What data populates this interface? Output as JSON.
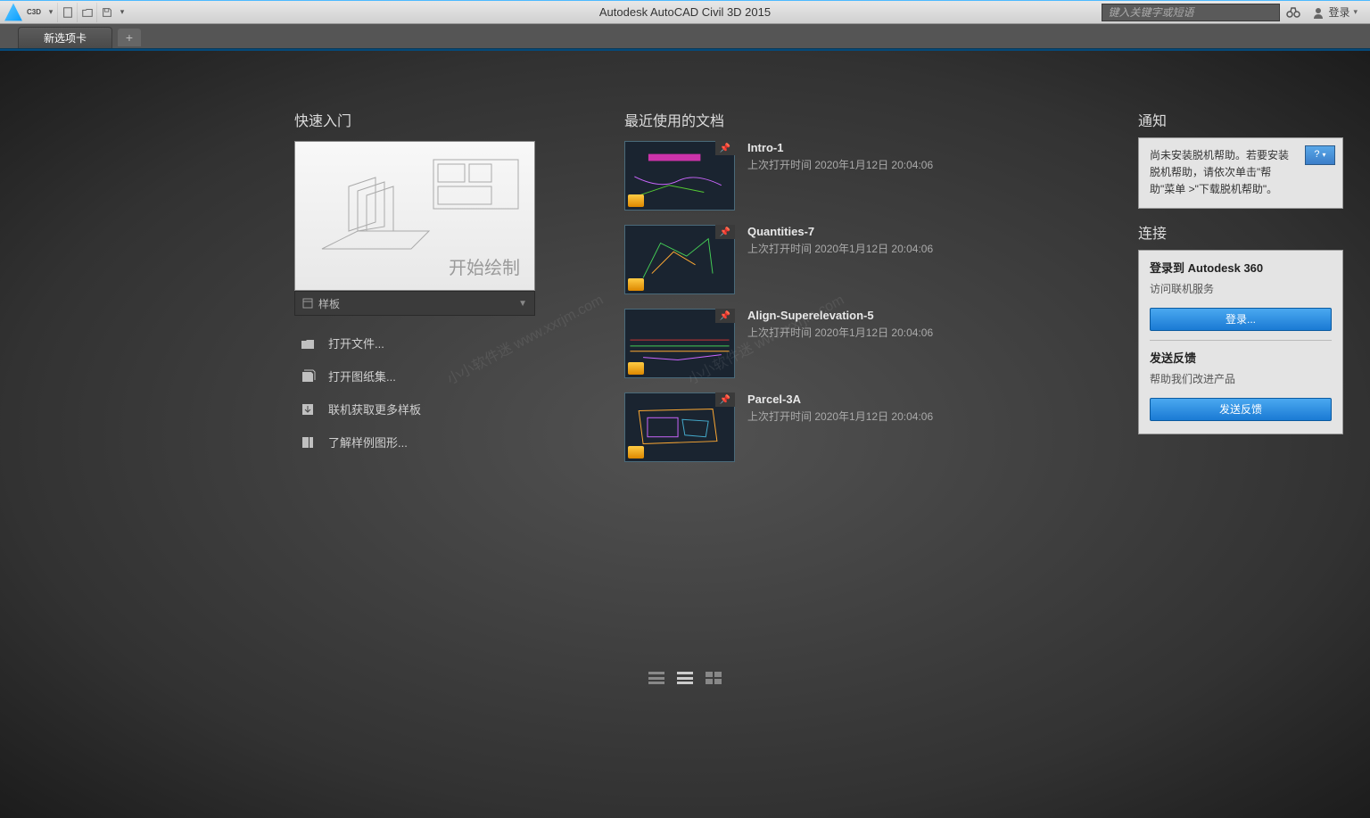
{
  "app": {
    "title": "Autodesk AutoCAD Civil 3D 2015",
    "c3d_label": "C3D",
    "search_placeholder": "键入关键字或短语",
    "login_label": "登录"
  },
  "tabs": {
    "active": "新选项卡"
  },
  "quick_start": {
    "title": "快速入门",
    "start_drawing": "开始绘制",
    "template_label": "样板",
    "actions": [
      {
        "label": "打开文件...",
        "key": "open-file"
      },
      {
        "label": "打开图纸集...",
        "key": "open-sheetset"
      },
      {
        "label": "联机获取更多样板",
        "key": "get-templates"
      },
      {
        "label": "了解样例图形...",
        "key": "explore-samples"
      }
    ]
  },
  "recent": {
    "title": "最近使用的文档",
    "date_prefix": "上次打开时间",
    "items": [
      {
        "name": "Intro-1",
        "date": "2020年1月12日 20:04:06"
      },
      {
        "name": "Quantities-7",
        "date": "2020年1月12日 20:04:06"
      },
      {
        "name": "Align-Superelevation-5",
        "date": "2020年1月12日 20:04:06"
      },
      {
        "name": "Parcel-3A",
        "date": "2020年1月12日 20:04:06"
      }
    ]
  },
  "notify": {
    "title": "通知",
    "message": "尚未安装脱机帮助。若要安装脱机帮助，请依次单击\"帮助\"菜单 >\"下载脱机帮助\"。",
    "help_icon": "?"
  },
  "connect": {
    "title": "连接",
    "a360_title": "登录到 Autodesk 360",
    "a360_sub": "访问联机服务",
    "login_btn": "登录...",
    "feedback_title": "发送反馈",
    "feedback_sub": "帮助我们改进产品",
    "feedback_btn": "发送反馈"
  },
  "watermark": {
    "text1": "小小软件迷 www.xxrjm.com",
    "text2": "小小软件迷 www.xxrjm.com"
  }
}
